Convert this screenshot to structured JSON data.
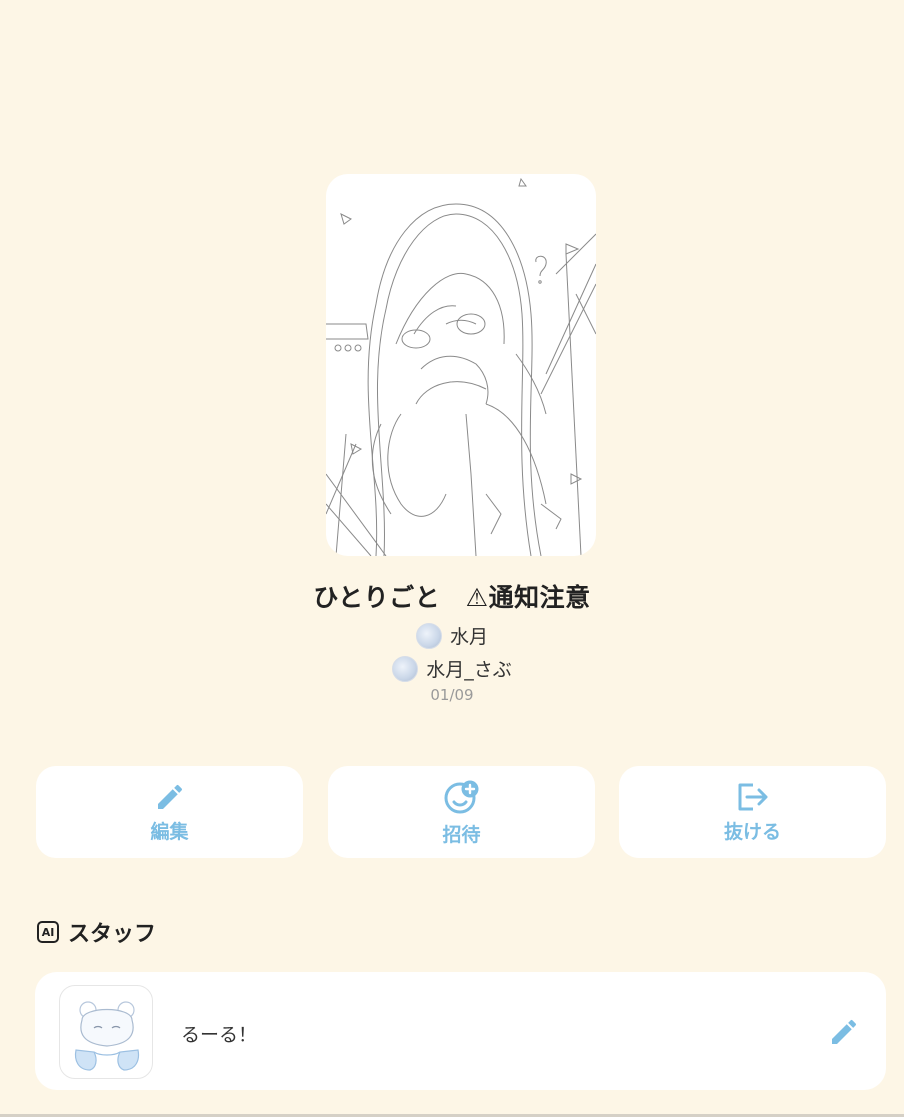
{
  "group": {
    "title": "ひとりごと　⚠通知注意",
    "members": [
      {
        "name": "水月"
      },
      {
        "name": "水月_さぶ"
      }
    ],
    "date": "01/09"
  },
  "actions": {
    "edit_label": "編集",
    "invite_label": "招待",
    "leave_label": "抜ける"
  },
  "staff": {
    "badge": "AI",
    "heading": "スタッフ",
    "items": [
      {
        "name": "るーる！"
      }
    ]
  },
  "colors": {
    "background": "#fdf6e6",
    "accent": "#7bbde3",
    "card": "#ffffff"
  },
  "icons": {
    "edit": "pencil-icon",
    "invite": "add-user-smile-icon",
    "leave": "logout-icon",
    "staff_edit": "pencil-icon"
  }
}
